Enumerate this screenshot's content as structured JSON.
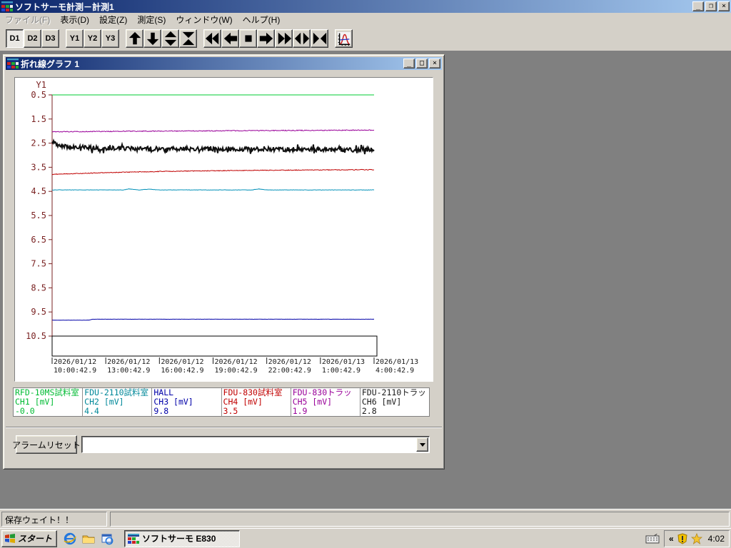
{
  "window": {
    "title": "ソフトサーモ計測－計測1",
    "caption_buttons": [
      "minimize",
      "restore",
      "close"
    ]
  },
  "menu": {
    "items": [
      {
        "label": "ファイル(F)",
        "disabled": true
      },
      {
        "label": "表示(D)",
        "disabled": false
      },
      {
        "label": "設定(Z)",
        "disabled": false
      },
      {
        "label": "測定(S)",
        "disabled": false
      },
      {
        "label": "ウィンドウ(W)",
        "disabled": false
      },
      {
        "label": "ヘルプ(H)",
        "disabled": false
      }
    ]
  },
  "toolbar": {
    "text_buttons": [
      "D1",
      "D2",
      "D3",
      "Y1",
      "Y2",
      "Y3"
    ],
    "pressed_button": "D1",
    "icon_buttons": [
      "scroll-up",
      "scroll-down",
      "expand-vertical",
      "compress-vertical",
      "fast-rewind",
      "step-back",
      "stop",
      "step-forward",
      "fast-forward",
      "expand-horizontal",
      "compress-horizontal",
      "graph-settings"
    ]
  },
  "graph_window": {
    "title": "折れ線グラフ 1",
    "caption_buttons": [
      "minimize",
      "maximize",
      "close"
    ],
    "alarm_reset_label": "アラームリセット",
    "combo_value": ""
  },
  "chart_data": {
    "type": "line",
    "y_axis": {
      "label": "Y1",
      "min": 0.5,
      "max": 10.5,
      "tick_interval": 1.0,
      "inverted": true,
      "unit": "mV"
    },
    "x_axis": {
      "labels": [
        {
          "date": "2026/01/12",
          "time": "10:00:42.9"
        },
        {
          "date": "2026/01/12",
          "time": "13:00:42.9"
        },
        {
          "date": "2026/01/12",
          "time": "16:00:42.9"
        },
        {
          "date": "2026/01/12",
          "time": "19:00:42.9"
        },
        {
          "date": "2026/01/12",
          "time": "22:00:42.9"
        },
        {
          "date": "2026/01/13",
          "time": "1:00:42.9"
        },
        {
          "date": "2026/01/13",
          "time": "4:00:42.9"
        }
      ]
    },
    "axis_color": "#7a2222",
    "series": [
      {
        "name": "CH1",
        "sensor": "RFD-10MS試料室",
        "current": "-0.0",
        "color": "#00cc33",
        "points": [
          [
            0,
            -0.0
          ],
          [
            1,
            -0.0
          ]
        ],
        "noise": 0,
        "width": 1,
        "spiky": false
      },
      {
        "name": "CH5",
        "sensor": "FDU-830トラッ",
        "current": "1.9",
        "color": "#990099",
        "points": [
          [
            0,
            2.03
          ],
          [
            0.2,
            2.01
          ],
          [
            0.5,
            1.99
          ],
          [
            0.8,
            1.97
          ],
          [
            1,
            1.96
          ]
        ],
        "noise": 0.018,
        "width": 1,
        "spiky": false
      },
      {
        "name": "CH6",
        "sensor": "FDU-2110トラッ",
        "current": "2.8",
        "color": "#111111",
        "points": [
          [
            0,
            2.5
          ],
          [
            0.02,
            2.58
          ],
          [
            0.06,
            2.66
          ],
          [
            0.12,
            2.7
          ],
          [
            0.3,
            2.73
          ],
          [
            0.6,
            2.75
          ],
          [
            1,
            2.77
          ]
        ],
        "noise": 0.09,
        "width": 2,
        "spiky": true
      },
      {
        "name": "CH4",
        "sensor": "FDU-830試料室",
        "current": "3.5",
        "color": "#c00000",
        "points": [
          [
            0,
            3.79
          ],
          [
            0.15,
            3.73
          ],
          [
            0.35,
            3.67
          ],
          [
            0.6,
            3.63
          ],
          [
            0.85,
            3.61
          ],
          [
            1,
            3.6
          ]
        ],
        "noise": 0.015,
        "width": 1,
        "spiky": false
      },
      {
        "name": "CH2",
        "sensor": "FDU-2110試料室",
        "current": "4.4",
        "color": "#0090b8",
        "points": [
          [
            0,
            4.44
          ],
          [
            0.22,
            4.44
          ],
          [
            0.24,
            4.4
          ],
          [
            0.27,
            4.44
          ],
          [
            0.3,
            4.41
          ],
          [
            0.33,
            4.44
          ],
          [
            0.62,
            4.44
          ],
          [
            0.64,
            4.4
          ],
          [
            0.67,
            4.44
          ],
          [
            1,
            4.44
          ]
        ],
        "noise": 0.008,
        "width": 1,
        "spiky": false
      },
      {
        "name": "CH3",
        "sensor": "HALL",
        "current": "9.8",
        "color": "#0000a8",
        "points": [
          [
            0,
            9.84
          ],
          [
            0.115,
            9.84
          ],
          [
            0.125,
            9.8
          ],
          [
            1,
            9.8
          ]
        ],
        "noise": 0.004,
        "width": 1,
        "spiky": false
      }
    ]
  },
  "legend": {
    "channels": [
      {
        "sensor": "RFD-10MS試料室",
        "channel": "CH1 [mV]",
        "value": "-0.0",
        "color": "#00bb33"
      },
      {
        "sensor": "FDU-2110試料室",
        "channel": "CH2 [mV]",
        "value": "4.4",
        "color": "#008899"
      },
      {
        "sensor": "HALL",
        "channel": "CH3 [mV]",
        "value": "9.8",
        "color": "#0000a8"
      },
      {
        "sensor": "FDU-830試料室",
        "channel": "CH4 [mV]",
        "value": "3.5",
        "color": "#c00000"
      },
      {
        "sensor": "FDU-830トラッ",
        "channel": "CH5 [mV]",
        "value": "1.9",
        "color": "#990099"
      },
      {
        "sensor": "FDU-2110トラッ",
        "channel": "CH6 [mV]",
        "value": "2.8",
        "color": "#1a1a1a"
      }
    ]
  },
  "status_bar": {
    "message": "保存ウェイト！！"
  },
  "taskbar": {
    "start_label": "スタート",
    "quick_launch_icons": [
      "internet-explorer",
      "folder",
      "outlook-express"
    ],
    "task_label": "ソフトサーモ E830",
    "tray_icons": [
      "keyboard",
      "collapse-chevron",
      "security-shield",
      "star"
    ],
    "clock": "4:02"
  }
}
